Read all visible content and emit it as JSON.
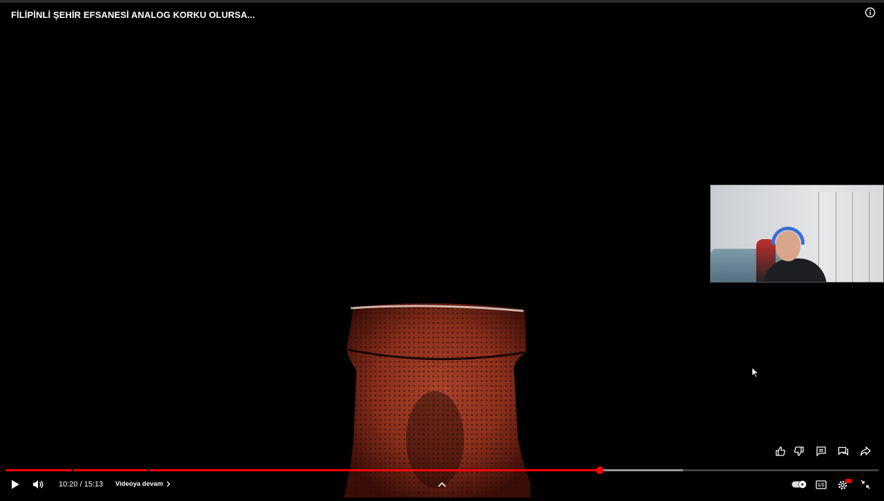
{
  "video": {
    "title": "FİLİPİNLİ ŞEHİR EFSANESİ ANALOG KORKU OLURSA..."
  },
  "player": {
    "time_display": "10:20 / 15:13",
    "current_time": "10:20",
    "duration": "15:13",
    "played_fraction": 0.68,
    "buffered_fraction": 0.776,
    "chapter_label": "Videoya devam",
    "autoplay_on": true,
    "accent_color": "#ff0000"
  },
  "controls": {
    "icons": [
      "play-icon",
      "volume-icon",
      "chevron-up-icon",
      "autoplay-toggle",
      "subtitles-icon",
      "settings-icon",
      "exit-fullscreen-icon"
    ],
    "actions": [
      "like-icon",
      "dislike-icon",
      "comments-icon",
      "live-chat-icon",
      "share-icon"
    ],
    "info_icon": "info-icon"
  }
}
